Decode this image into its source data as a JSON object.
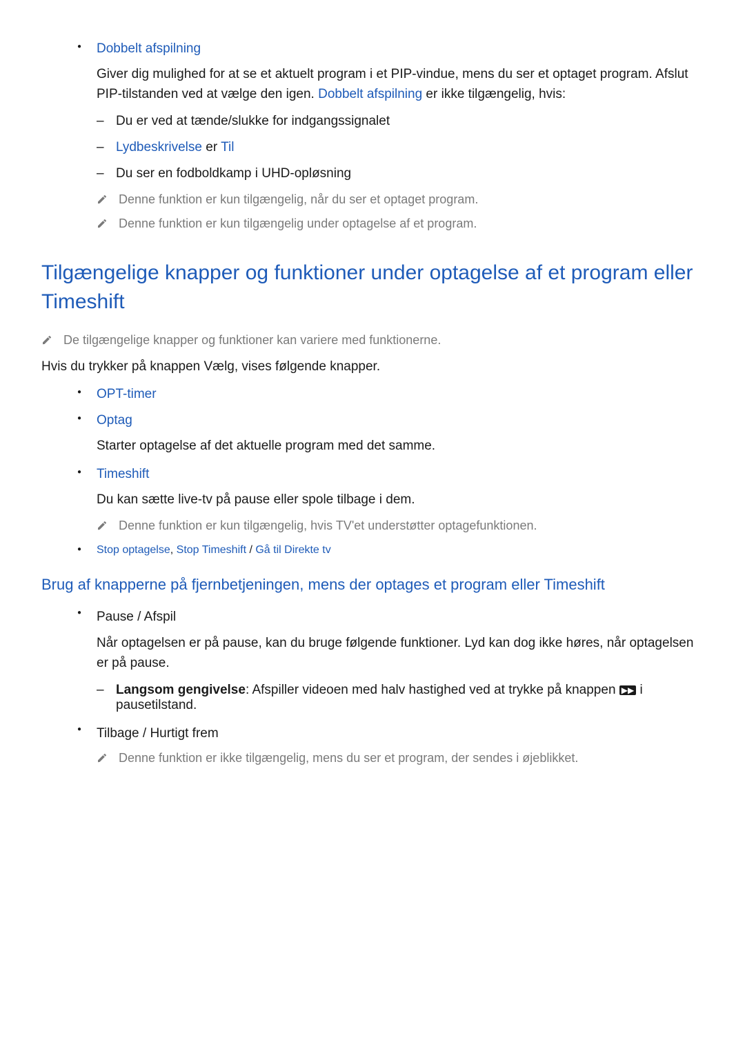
{
  "dobbelt": {
    "title": "Dobbelt afspilning",
    "desc_1": "Giver dig mulighed for at se et aktuelt program i et PIP-vindue, mens du ser et optaget program. Afslut PIP-tilstanden ved at vælge den igen. ",
    "desc_blue": "Dobbelt afspilning",
    "desc_2": " er ikke tilgængelig, hvis:",
    "dash1": "Du er ved at tænde/slukke for indgangssignalet",
    "dash2_a": "Lydbeskrivelse",
    "dash2_b": " er ",
    "dash2_c": "Til",
    "dash3": "Du ser en fodboldkamp i UHD-opløsning",
    "note1": "Denne funktion er kun tilgængelig, når du ser et optaget program.",
    "note2": "Denne funktion er kun tilgængelig under optagelse af et program."
  },
  "section1": {
    "heading": "Tilgængelige knapper og funktioner under optagelse af et program eller Timeshift",
    "note": "De tilgængelige knapper og funktioner kan variere med funktionerne.",
    "intro": "Hvis du trykker på knappen Vælg, vises følgende knapper.",
    "items": {
      "opt_timer": "OPT-timer",
      "optag": "Optag",
      "optag_desc": "Starter optagelse af det aktuelle program med det samme.",
      "timeshift": "Timeshift",
      "timeshift_desc": "Du kan sætte live-tv på pause eller spole tilbage i dem.",
      "timeshift_note": "Denne funktion er kun tilgængelig, hvis TV'et understøtter optagefunktionen.",
      "stop_a": "Stop optagelse",
      "stop_sep1": ", ",
      "stop_b": "Stop Timeshift",
      "stop_sep2": " / ",
      "stop_c": "Gå til Direkte tv"
    }
  },
  "sub1": {
    "heading": "Brug af knapperne på fjernbetjeningen, mens der optages et program eller Timeshift",
    "pause_title": "Pause / Afspil",
    "pause_desc": "Når optagelsen er på pause, kan du bruge følgende funktioner. Lyd kan dog ikke høres, når optagelsen er på pause.",
    "langsom_label": "Langsom gengivelse",
    "langsom_desc_1": ": Afspiller videoen med halv hastighed ved at trykke på knappen ",
    "langsom_desc_2": " i pausetilstand.",
    "tilbage_title": "Tilbage / Hurtigt frem",
    "tilbage_note": "Denne funktion er ikke tilgængelig, mens du ser et program, der sendes i øjeblikket."
  }
}
